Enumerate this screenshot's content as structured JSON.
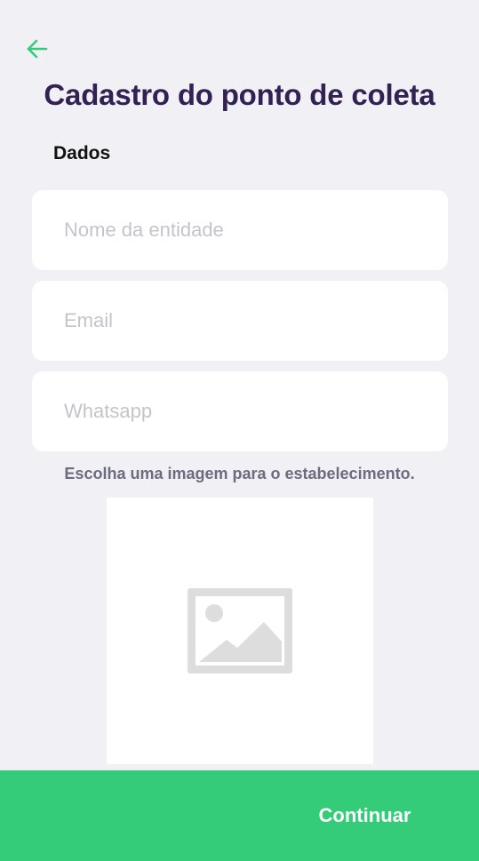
{
  "header": {
    "back_icon": "arrow-left-icon",
    "title": "Cadastro do ponto de coleta"
  },
  "form": {
    "section_label": "Dados",
    "fields": {
      "name": {
        "value": "",
        "placeholder": "Nome da entidade"
      },
      "email": {
        "value": "",
        "placeholder": "Email"
      },
      "whatsapp": {
        "value": "",
        "placeholder": "Whatsapp"
      }
    },
    "image_hint": "Escolha uma imagem para o estabelecimento.",
    "image_placeholder_icon": "image-placeholder-icon"
  },
  "footer": {
    "continue_label": "Continuar"
  },
  "colors": {
    "background": "#f0f0f5",
    "title": "#322153",
    "accent": "#34cb79",
    "hint": "#6c6c80",
    "placeholder": "#c4c4cc"
  }
}
